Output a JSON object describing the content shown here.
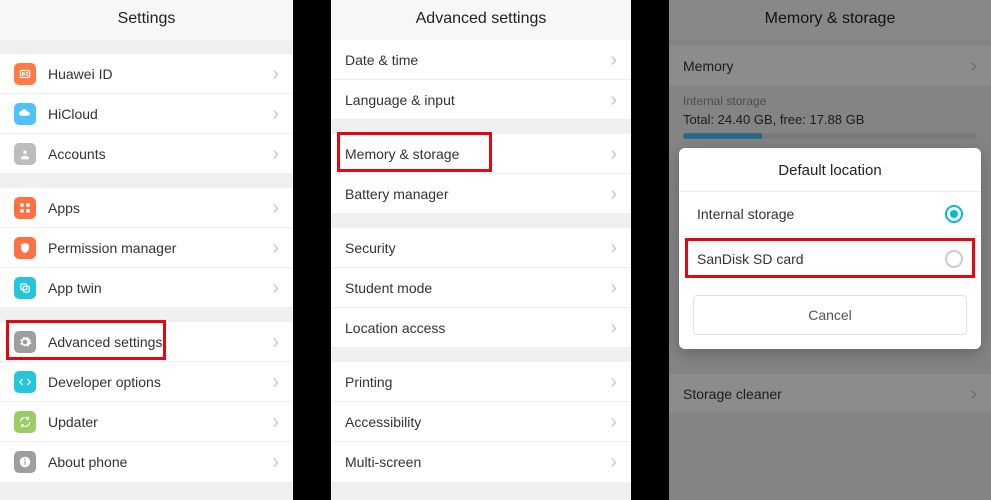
{
  "screen1": {
    "title": "Settings",
    "groups": [
      [
        {
          "id": "huawei-id",
          "label": "Huawei ID",
          "icon_bg": "#ff7a45",
          "icon": "id"
        },
        {
          "id": "hicloud",
          "label": "HiCloud",
          "icon_bg": "#4fc3f7",
          "icon": "cloud"
        },
        {
          "id": "accounts",
          "label": "Accounts",
          "icon_bg": "#bdbdbd",
          "icon": "user"
        }
      ],
      [
        {
          "id": "apps",
          "label": "Apps",
          "icon_bg": "#ff7043",
          "icon": "grid"
        },
        {
          "id": "permission-manager",
          "label": "Permission manager",
          "icon_bg": "#ff7043",
          "icon": "shield"
        },
        {
          "id": "app-twin",
          "label": "App twin",
          "icon_bg": "#26c6da",
          "icon": "twin"
        }
      ],
      [
        {
          "id": "advanced-settings",
          "label": "Advanced settings",
          "icon_bg": "#9e9e9e",
          "icon": "gear",
          "highlight": true
        },
        {
          "id": "developer-options",
          "label": "Developer options",
          "icon_bg": "#26c6da",
          "icon": "code"
        },
        {
          "id": "updater",
          "label": "Updater",
          "icon_bg": "#9ccc65",
          "icon": "update"
        },
        {
          "id": "about-phone",
          "label": "About phone",
          "icon_bg": "#9e9e9e",
          "icon": "info"
        }
      ]
    ]
  },
  "screen2": {
    "title": "Advanced settings",
    "groups": [
      [
        {
          "id": "date-time",
          "label": "Date & time"
        },
        {
          "id": "language-input",
          "label": "Language & input"
        }
      ],
      [
        {
          "id": "memory-storage",
          "label": "Memory & storage",
          "highlight": true
        },
        {
          "id": "battery-manager",
          "label": "Battery manager"
        }
      ],
      [
        {
          "id": "security",
          "label": "Security"
        },
        {
          "id": "student-mode",
          "label": "Student mode"
        },
        {
          "id": "location-access",
          "label": "Location access"
        }
      ],
      [
        {
          "id": "printing",
          "label": "Printing"
        },
        {
          "id": "accessibility",
          "label": "Accessibility"
        },
        {
          "id": "multi-screen",
          "label": "Multi-screen"
        }
      ]
    ]
  },
  "screen3": {
    "title": "Memory & storage",
    "memory_row": "Memory",
    "internal_storage_label": "Internal storage",
    "total_line": "Total: 24.40 GB, free: 17.88 GB",
    "dialog": {
      "title": "Default location",
      "options": [
        {
          "id": "internal-storage",
          "label": "Internal storage",
          "selected": true
        },
        {
          "id": "sandisk-sd",
          "label": "SanDisk SD card",
          "selected": false,
          "highlight": true
        }
      ],
      "cancel": "Cancel"
    },
    "storage_cleaner": "Storage cleaner"
  }
}
